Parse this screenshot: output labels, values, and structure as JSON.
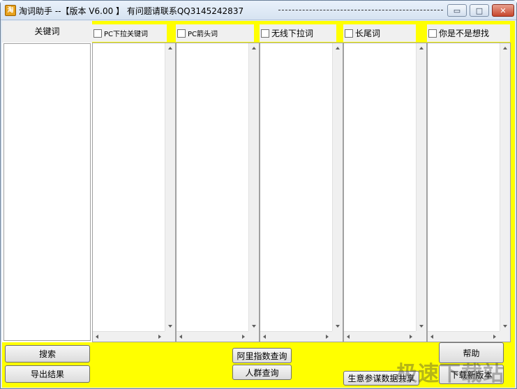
{
  "window": {
    "title": "淘词助手 --【版本 V6.00 】 有问题请联系QQ3145242837",
    "app_icon_glyph": "淘",
    "controls": {
      "minimize": "▭",
      "maximize": "□",
      "close": "✕"
    }
  },
  "colors": {
    "client_background": "#ffff00",
    "title_bar": "#dfe8f3"
  },
  "keyword_column": {
    "header": "关键词"
  },
  "columns": [
    {
      "label": "PC下拉关键词",
      "checked": false
    },
    {
      "label": "PC箭头词",
      "checked": false
    },
    {
      "label": "无线下拉词",
      "checked": false
    },
    {
      "label": "长尾词",
      "checked": false
    },
    {
      "label": "你是不是想找",
      "checked": false
    }
  ],
  "buttons": {
    "search": "搜索",
    "export": "导出结果",
    "ali_index": "阿里指数查询",
    "crowd": "人群查询",
    "business": "生意参谋数据共享",
    "help": "帮助",
    "download": "下载新版本"
  },
  "watermark": "极速下载站"
}
